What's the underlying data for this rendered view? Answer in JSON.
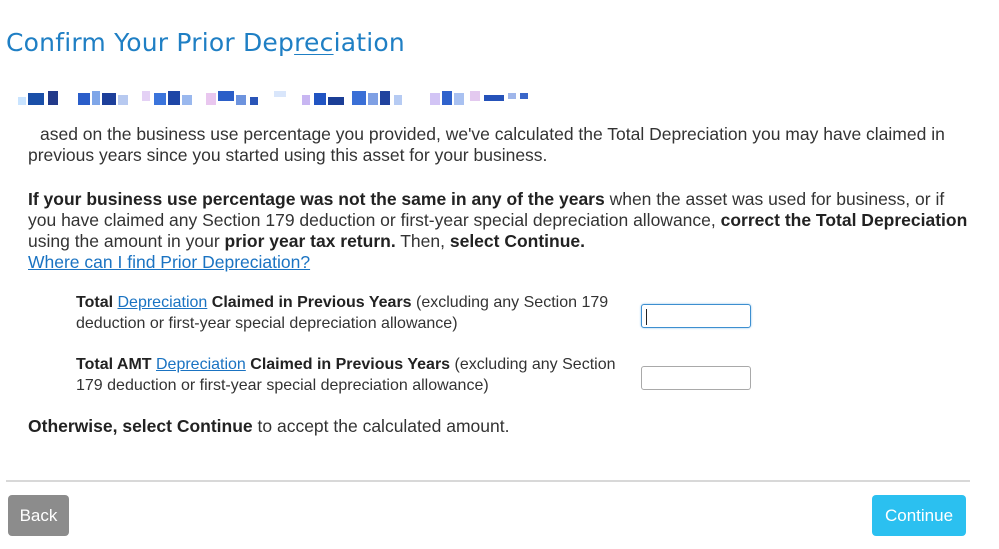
{
  "page": {
    "title_part1": "Confirm Your Prior Dep",
    "title_part2": "rec",
    "title_part3": "iation"
  },
  "intro": {
    "text": "ased on the business use percentage you provided, we've calculated the Total Depreciation you may have claimed in previous years since you started using this asset for your business."
  },
  "instructions": {
    "bold1": "If your business use percentage was not the same in any of the years",
    "text1": " when the asset was used for business, or if you have claimed any Section 179 deduction or first-year special depreciation allowance, ",
    "bold2": "correct the Total Depreciation",
    "text2": " using the amount in your ",
    "bold3": "prior year tax return.",
    "text3": " Then, ",
    "bold4": "select Continue.",
    "help_link": "Where can I find Prior Depreciation?"
  },
  "fields": [
    {
      "label_bold1": "Total ",
      "label_link": "Depreciation",
      "label_bold2": " Claimed in Previous Years",
      "label_rest": " (excluding any Section 179 deduction or first-year special depreciation allowance)",
      "value": ""
    },
    {
      "label_bold1": "Total AMT ",
      "label_link": "Depreciation",
      "label_bold2": " Claimed in Previous Years",
      "label_rest": " (excluding any Section 179 deduction or first-year special depreciation allowance)",
      "value": ""
    }
  ],
  "otherwise": {
    "bold": "Otherwise, select Continue",
    "text": " to accept the calculated amount."
  },
  "buttons": {
    "back": "Back",
    "continue": "Continue"
  },
  "colors": {
    "title": "#1f7fc4",
    "link": "#1a73c2",
    "continue_button": "#2bc0f0",
    "back_button": "#8c8c8c"
  }
}
